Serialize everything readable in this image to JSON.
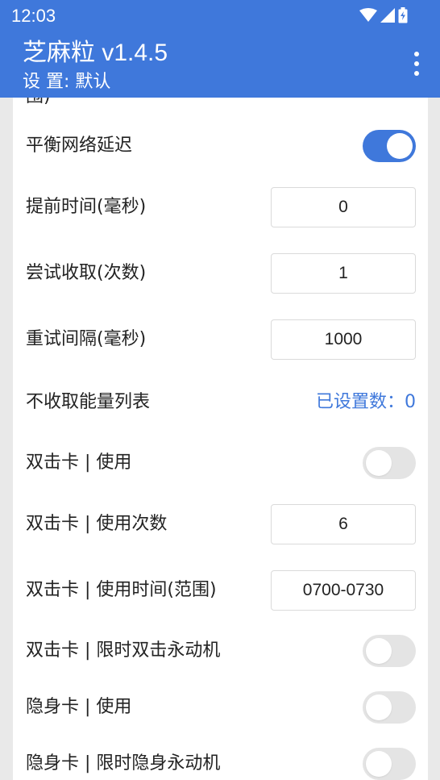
{
  "status_bar": {
    "time": "12:03",
    "icons": [
      "wifi-icon",
      "cell-signal-icon",
      "battery-charging-icon"
    ]
  },
  "app_bar": {
    "title": "芝麻粒 v1.4.5",
    "subtitle": "设 置: 默认",
    "menu_icon": "overflow-menu-icon"
  },
  "colors": {
    "primary": "#3f78db",
    "toggle_off": "#e4e4e4",
    "background": "#e9e9e9",
    "card": "#ffffff"
  },
  "settings": {
    "cut_off_text": "围)",
    "balance_network_delay": {
      "label": "平衡网络延迟",
      "enabled": true
    },
    "advance_time": {
      "label": "提前时间(毫秒)",
      "value": "0"
    },
    "try_collect": {
      "label": "尝试收取(次数)",
      "value": "1"
    },
    "retry_interval": {
      "label": "重试间隔(毫秒)",
      "value": "1000"
    },
    "no_collect_list": {
      "label": "不收取能量列表",
      "value": "已设置数：0"
    },
    "double_card_use": {
      "label": "双击卡 | 使用",
      "enabled": false
    },
    "double_card_count": {
      "label": "双击卡 | 使用次数",
      "value": "6"
    },
    "double_card_time": {
      "label": "双击卡 | 使用时间(范围)",
      "value": "0700-0730"
    },
    "double_card_limited": {
      "label": "双击卡 | 限时双击永动机",
      "enabled": false
    },
    "stealth_card_use": {
      "label": "隐身卡 | 使用",
      "enabled": false
    },
    "stealth_card_limited": {
      "label": "隐身卡 | 限时隐身永动机",
      "enabled": false
    }
  }
}
